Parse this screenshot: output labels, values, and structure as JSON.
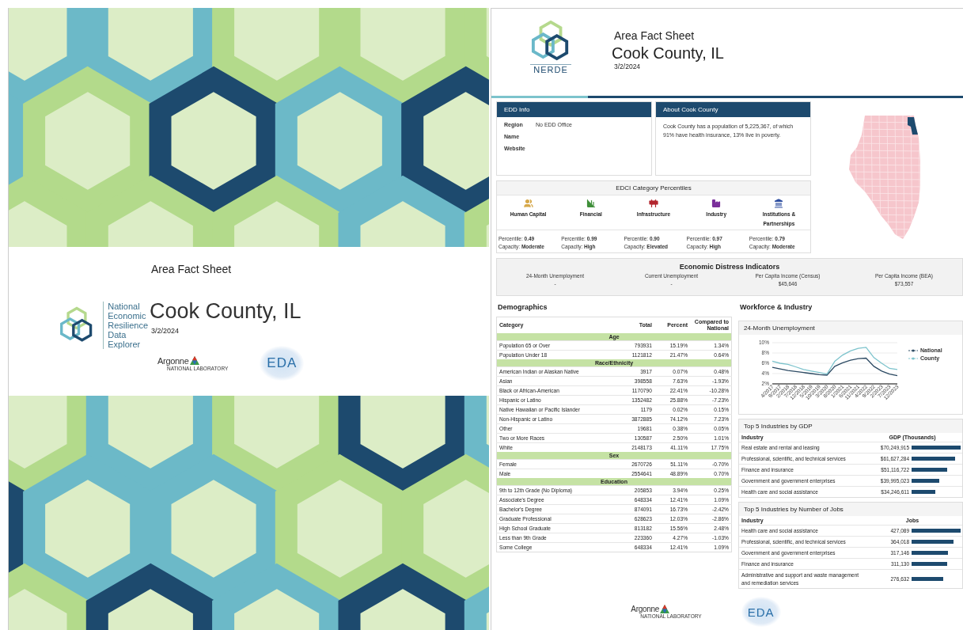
{
  "cover": {
    "title": "Area Fact Sheet",
    "place": "Cook County, IL",
    "date": "3/2/2024",
    "logo_lines": [
      "National",
      "Economic",
      "Resilience",
      "Data",
      "Explorer"
    ],
    "argonne": "Argonne",
    "argonne_sub": "NATIONAL LABORATORY",
    "eda": "EDA"
  },
  "header": {
    "logo_text": "NERDE",
    "title": "Area Fact Sheet",
    "place": "Cook County, IL",
    "date": "3/2/2024"
  },
  "edd_info": {
    "title": "EDD Info",
    "fields": [
      {
        "label": "Region",
        "value": "No EDD Office"
      },
      {
        "label": "Name"
      },
      {
        "label": "Website"
      }
    ]
  },
  "about": {
    "title": "About Cook County",
    "text": "Cook County has a population of 5,225,367, of which 91% have health insurance, 13% live in poverty."
  },
  "edci": {
    "title": "EDCI Category Percentiles",
    "categories": [
      {
        "kind": "people",
        "name": "Human Capital",
        "color": "#d6a849",
        "percentile": "Percentile: **0.49**",
        "capacity": "Capacity: **Moderate**"
      },
      {
        "kind": "finance",
        "name": "Financial",
        "color": "#3f8f3a",
        "percentile": "Percentile: **0.99**",
        "capacity": "Capacity: **High**"
      },
      {
        "kind": "infrastructure",
        "name": "Infrastructure",
        "color": "#b3262f",
        "percentile": "Percentile: **0.90**",
        "capacity": "Capacity: **Elevated**"
      },
      {
        "kind": "industry",
        "name": "Industry",
        "color": "#7b2f9b",
        "percentile": "Percentile: **0.97**",
        "capacity": "Capacity: **High**"
      },
      {
        "kind": "institutions",
        "name": "Institutions & Partnerships",
        "color": "#2f4fa0",
        "percentile": "Percentile: **0.79**",
        "capacity": "Capacity: **Moderate**"
      }
    ]
  },
  "distress": {
    "title": "Economic Distress Indicators",
    "indicators": [
      {
        "label": "24-Month Unemployment",
        "value": "-"
      },
      {
        "label": "Current Unemployment",
        "value": "-"
      },
      {
        "label": "Per Capita Income (Census)",
        "value": "$45,646"
      },
      {
        "label": "Per Capita Income (BEA)",
        "value": "$73,557"
      }
    ]
  },
  "demographics": {
    "title": "Demographics",
    "columns": [
      "Category",
      "Total",
      "Percent",
      "Compared to National"
    ],
    "groups": [
      {
        "name": "Age",
        "rows": [
          [
            "Population 65 or Over",
            "793931",
            "15.19%",
            "1.34%"
          ],
          [
            "Population Under 18",
            "1121812",
            "21.47%",
            "0.64%"
          ]
        ]
      },
      {
        "name": "Race/Ethnicity",
        "rows": [
          [
            "American Indian or Alaskan Native",
            "3917",
            "0.07%",
            "0.48%"
          ],
          [
            "Asian",
            "398558",
            "7.63%",
            "-1.93%"
          ],
          [
            "Black or African-American",
            "1170790",
            "22.41%",
            "-10.28%"
          ],
          [
            "Hispanic or Latino",
            "1352482",
            "25.88%",
            "-7.23%"
          ],
          [
            "Native Hawaiian or Pacific Islander",
            "1179",
            "0.02%",
            "0.15%"
          ],
          [
            "Non-Hispanic or Latino",
            "3872885",
            "74.12%",
            "7.23%"
          ],
          [
            "Other",
            "19681",
            "0.38%",
            "0.05%"
          ],
          [
            "Two or More Races",
            "130587",
            "2.50%",
            "1.01%"
          ],
          [
            "White",
            "2148173",
            "41.11%",
            "17.75%"
          ]
        ]
      },
      {
        "name": "Sex",
        "rows": [
          [
            "Female",
            "2670726",
            "51.11%",
            "-0.70%"
          ],
          [
            "Male",
            "2554641",
            "48.89%",
            "0.70%"
          ]
        ]
      },
      {
        "name": "Education",
        "rows": [
          [
            "9th to 12th Grade (No Diploma)",
            "205853",
            "3.94%",
            "0.25%"
          ],
          [
            "Associate's Degree",
            "648334",
            "12.41%",
            "1.09%"
          ],
          [
            "Bachelor's Degree",
            "874091",
            "16.73%",
            "-2.42%"
          ],
          [
            "Graduate Professional",
            "628623",
            "12.03%",
            "-2.86%"
          ],
          [
            "High School Graduate",
            "813182",
            "15.56%",
            "2.48%"
          ],
          [
            "Less than 9th Grade",
            "223360",
            "4.27%",
            "-1.03%"
          ],
          [
            "Some College",
            "648334",
            "12.41%",
            "1.09%"
          ]
        ]
      }
    ]
  },
  "workforce": {
    "title": "Workforce & Industry",
    "unemployment": {
      "title": "24-Month Unemployment",
      "chart_data": {
        "type": "line",
        "grid": true,
        "legend": true,
        "categories": [
          "4/2017",
          "9/2017",
          "2/2018",
          "7/2018",
          "12/2018",
          "5/2019",
          "10/2019",
          "3/2020",
          "8/2020",
          "1/2021",
          "6/2021",
          "11/2021",
          "4/2022",
          "9/2022",
          "2/2023",
          "7/2023",
          "12/2023"
        ],
        "ylim": [
          2,
          10
        ],
        "yticks": [
          {
            "value": 2,
            "label": "2%"
          },
          {
            "value": 4,
            "label": "4%"
          },
          {
            "value": 6,
            "label": "6%"
          },
          {
            "value": 8,
            "label": "8%"
          },
          {
            "value": 10,
            "label": "10%"
          }
        ],
        "series": [
          {
            "name": "National",
            "color": "#2c4a63",
            "values": [
              5.2,
              4.9,
              4.6,
              4.4,
              4.2,
              4.0,
              3.8,
              3.7,
              5.4,
              6.1,
              6.6,
              6.9,
              7.0,
              5.4,
              4.5,
              3.9,
              3.6
            ]
          },
          {
            "name": "County",
            "color": "#7cc3cc",
            "values": [
              6.4,
              6.0,
              5.8,
              5.3,
              4.8,
              4.5,
              4.2,
              3.9,
              6.4,
              7.6,
              8.4,
              8.9,
              9.1,
              7.1,
              6.0,
              5.0,
              4.8
            ]
          }
        ]
      }
    },
    "gdp": {
      "title": "Top 5 Industries by GDP",
      "columns": [
        "Industry",
        "GDP (Thousands)"
      ],
      "rows": [
        {
          "industry": "Real estate and rental and leasing",
          "value": "$70,249,915",
          "level": 1
        },
        {
          "industry": "Professional, scientific, and technical services",
          "value": "$61,627,284",
          "level": 0.88
        },
        {
          "industry": "Finance and insurance",
          "value": "$51,116,722",
          "level": 0.73
        },
        {
          "industry": "Government and government enterprises",
          "value": "$39,995,023",
          "level": 0.57
        },
        {
          "industry": "Health care and social assistance",
          "value": "$34,246,611",
          "level": 0.49
        }
      ]
    },
    "jobs": {
      "title": "Top 5 Industries by Number of Jobs",
      "columns": [
        "Industry",
        "Jobs"
      ],
      "rows": [
        {
          "industry": "Health care and social assistance",
          "value": "427,089",
          "level": 1
        },
        {
          "industry": "Professional, scientific, and technical services",
          "value": "364,018",
          "level": 0.85
        },
        {
          "industry": "Government and government enterprises",
          "value": "317,146",
          "level": 0.74
        },
        {
          "industry": "Finance and insurance",
          "value": "311,130",
          "level": 0.73
        },
        {
          "industry": "Administrative and support and waste management and remediation services",
          "value": "276,632",
          "level": 0.65
        }
      ]
    }
  },
  "footer": {
    "argonne": "Argonne",
    "argonne_sub": "NATIONAL LABORATORY",
    "eda": "EDA"
  }
}
